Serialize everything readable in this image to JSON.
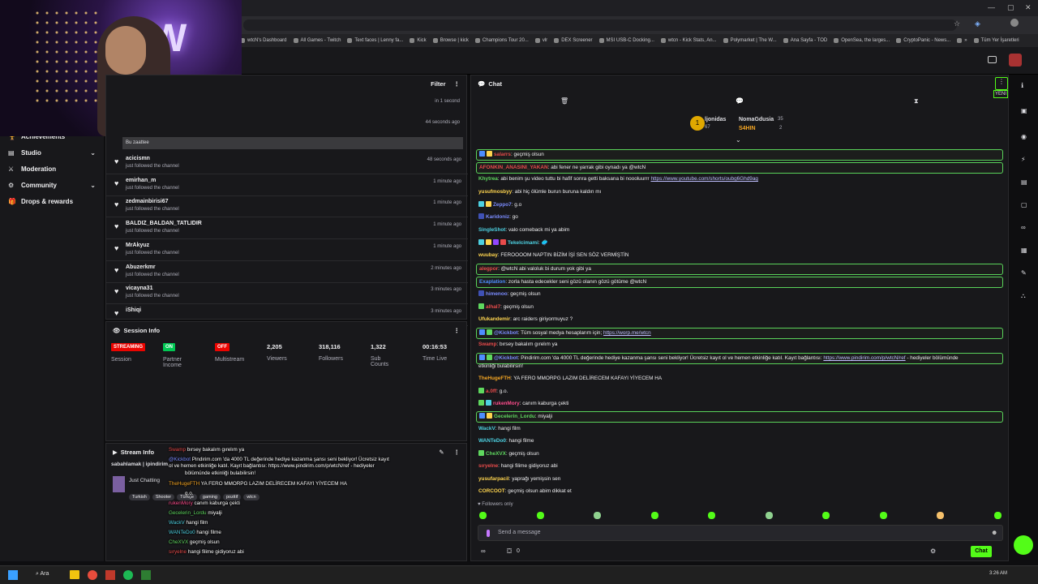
{
  "browser": {
    "bookmarks": [
      "wtcN's Dashboard",
      "All Games - Twitch",
      "Text faces | Lenny fa...",
      "Kick",
      "Browse | kick",
      "Champions Tour 20...",
      "vlr",
      "DEX Screener",
      "MSI USB-C Docking...",
      "wtcn - Kick Stats, An...",
      "Polymarket | The W...",
      "Ana Sayfa - TOD",
      "OpenSea, the larges...",
      "CryptoPanic - News...",
      "»",
      "Tüm Yer İşaretleri"
    ]
  },
  "sidebar": {
    "items": [
      {
        "label": "Achievements",
        "icon": "trophy-icon",
        "expand": false
      },
      {
        "label": "Studio",
        "icon": "studio-icon",
        "expand": true
      },
      {
        "label": "Moderation",
        "icon": "sword-icon",
        "expand": false
      },
      {
        "label": "Community",
        "icon": "gear-icon",
        "expand": true
      },
      {
        "label": "Drops & rewards",
        "icon": "gift-icon",
        "expand": false
      }
    ]
  },
  "activity": {
    "filter_label": "Filter",
    "top_times": [
      "in 1 second",
      "44 seconds ago"
    ],
    "banner_text": "Bu zaattee",
    "events": [
      {
        "user": "acicismn",
        "text": "just followed the channel",
        "time": "48 seconds ago"
      },
      {
        "user": "emirhan_m",
        "text": "just followed the channel",
        "time": "1 minute ago"
      },
      {
        "user": "zedmainbirisi67",
        "text": "just followed the channel",
        "time": "1 minute ago"
      },
      {
        "user": "BALDIZ_BALDAN_TATLIDIR",
        "text": "just followed the channel",
        "time": "1 minute ago"
      },
      {
        "user": "MrAkyuz",
        "text": "just followed the channel",
        "time": "1 minute ago"
      },
      {
        "user": "Abuzerkmr",
        "text": "just followed the channel",
        "time": "2 minutes ago"
      },
      {
        "user": "vicayna31",
        "text": "just followed the channel",
        "time": "3 minutes ago"
      },
      {
        "user": "iShiqi",
        "text": "",
        "time": "3 minutes ago"
      }
    ]
  },
  "session": {
    "title": "Session Info",
    "cols": [
      {
        "badge": "STREAMING",
        "badge_color": "#eb0400",
        "label": "Session"
      },
      {
        "badge": "ON",
        "badge_color": "#00c853",
        "label": "Partner Income"
      },
      {
        "badge": "OFF",
        "badge_color": "#eb0400",
        "label": "Multistream"
      },
      {
        "value": "2,205",
        "label": "Viewers"
      },
      {
        "value": "318,116",
        "label": "Followers"
      },
      {
        "value": "1,322",
        "label": "Sub Counts"
      },
      {
        "value": "00:16:53",
        "label": "Time Live"
      }
    ]
  },
  "stream_info": {
    "title": "Stream Info",
    "stream_title": "sabahlamak | ipindirim",
    "category": "Just Chatting",
    "tags": [
      "Turkish",
      "Shooter",
      "Türkçe",
      "gaming",
      "pozitif",
      "wtcn"
    ]
  },
  "overlay_lines": [
    {
      "name": "Swamp",
      "color": "#e84b4b",
      "text": "bırsey bakalım gırelım ya"
    },
    {
      "name": "@Kickbot",
      "color": "#7b8cff",
      "text": "Pindirim.com 'da 4000 TL değerinde hediye kazanma şansı seni bekliyor! Ücretsiz kayıt"
    },
    {
      "name": "",
      "color": "#fff",
      "text": "ol ve hemen etkinliğe katıl. Kayıt bağlantısı: https://www.pindirim.com/p/wtcN/ref - hediyeler"
    },
    {
      "name": "",
      "color": "#fff",
      "text": "bölümünde etkinliği bulabilirsin!"
    },
    {
      "name": "TheHugeFTH",
      "color": "#f5a623",
      "text": "YA FERO MMORPG LAZIM DELİRECEM KAFAYI YİYECEM HA"
    },
    {
      "name": "",
      "color": "#fff",
      "text": "g.o."
    },
    {
      "name": "rukenMory",
      "color": "#ff4d8d",
      "text": "canım kaburga çekti"
    },
    {
      "name": "Gecelerin_Lordu",
      "color": "#5fd85f",
      "text": "miyalji"
    },
    {
      "name": "WackV",
      "color": "#4dd0e1",
      "text": "hangi film"
    },
    {
      "name": "WANTeDo0",
      "color": "#4dd0e1",
      "text": "hangi filme"
    },
    {
      "name": "CheXVX",
      "color": "#5fd85f",
      "text": "geçmiş olsun"
    },
    {
      "name": "sıryelne",
      "color": "#e84b4b",
      "text": "hangi filime gidiyoruz abi"
    },
    {
      "name": "yusufarpacil",
      "color": "#ffd54f",
      "text": "yaprağı yemişsin sen"
    },
    {
      "name": "CORCOOT",
      "color": "#fff",
      "text": "geçmiş olsun abim dikkat et"
    }
  ],
  "chat": {
    "title": "Chat",
    "top_users": [
      {
        "name": "ljonidas",
        "count": "67"
      },
      {
        "name": "NomaGdusia",
        "count": "35"
      },
      {
        "name": "S4HIN",
        "count": "2"
      }
    ],
    "lines": [
      {
        "name": "salarrs",
        "color": "#e84b4b",
        "text": "geçmiş olsun",
        "hl": true,
        "icons": [
          "#4d8dff",
          "#ffd54f"
        ]
      },
      {
        "name": "AFONKIN_ANASINI_YAKAN",
        "color": "#e84b4b",
        "text": "abi fener ne yarrak gibi oynadı ya @wtcN",
        "hl": true,
        "icons": []
      },
      {
        "name": "Khytrea",
        "color": "#5fd85f",
        "text": "abi benim şu video tuttu bi hafif sonra getti baksana bi noooluurrr",
        "link": "https://www.youtube.com/shorts/oubg6Ghd9ag",
        "hl": false,
        "icons": []
      },
      {
        "name": "yusufmosbyy",
        "color": "#ffd54f",
        "text": "abi hiç ölümle burun buruna kaldın mı",
        "hl": false,
        "icons": []
      },
      {
        "name": "Zeppo7",
        "color": "#7b8cff",
        "text": "g.o",
        "hl": false,
        "icons": [
          "#4dd0e1",
          "#ffd54f"
        ]
      },
      {
        "name": "Karidoniz",
        "color": "#7b8cff",
        "text": "go",
        "hl": false,
        "icons": [
          "#3f51b5"
        ]
      },
      {
        "name": "SingleShot",
        "color": "#4dd0e1",
        "text": "valo comeback mi ya abim",
        "hl": false,
        "icons": []
      },
      {
        "name": "Tekelcimami",
        "color": "#4dd0e1",
        "text": "🥏",
        "hl": false,
        "icons": [
          "#4dd0e1",
          "#ffd54f",
          "#9146ff",
          "#e84b4b"
        ]
      },
      {
        "name": "wuubay",
        "color": "#ffd54f",
        "text": "FEROOOOM NAPTIN BİZİM İŞİ SEN SÖZ VERMİŞTİN",
        "hl": false,
        "icons": []
      },
      {
        "name": "alegpor",
        "color": "#e84b4b",
        "text": "@wtcN abi valoluk bi durum yok gibi ya",
        "hl": true,
        "icons": []
      },
      {
        "name": "Exaplation",
        "color": "#4d8dff",
        "text": "zorla hasta edecekler seni gözü olanın gözü götüme @wtcN",
        "hl": true,
        "icons": []
      },
      {
        "name": "himenoo",
        "color": "#7b8cff",
        "text": "geçmiş olsun",
        "hl": false,
        "icons": [
          "#3f51b5"
        ]
      },
      {
        "name": "alhal7",
        "color": "#e84b4b",
        "text": "geçmiş olsun",
        "hl": false,
        "icons": [
          "#5fd85f"
        ]
      },
      {
        "name": "Ufukandemir",
        "color": "#ffd54f",
        "text": "arc raiders giriyormuyuz ?",
        "hl": false,
        "icons": []
      },
      {
        "name": "@Kickbot",
        "color": "#7b8cff",
        "text": "Tüm sosyal medya hesaplarım için;",
        "link": "https://worp.me/wtcn",
        "hl": true,
        "icons": [
          "#4d8dff",
          "#5fd85f"
        ]
      },
      {
        "name": "Swamp",
        "color": "#e84b4b",
        "text": "bırsey bakalım gırelım ya",
        "hl": false,
        "icons": []
      },
      {
        "name": "@Kickbot",
        "color": "#7b8cff",
        "text": "Pindirim.com 'da 4000 TL değerinde hediye kazanma şansı seni bekliyor! Ücretsiz kayıt ol ve hemen etkinliğe katıl. Kayıt bağlantısı:",
        "link": "https://www.pindirim.com/p/wtcN/ref",
        "tail": "- hediyeler bölümünde",
        "hl": true,
        "icons": [
          "#4d8dff",
          "#5fd85f"
        ]
      },
      {
        "name": "",
        "color": "#efeff1",
        "text": "etkinliği bulabilirsin!",
        "hl": false,
        "icons": []
      },
      {
        "name": "TheHugeFTH",
        "color": "#f5a623",
        "text": "YA FERO MMORPG LAZIM DELİRECEM KAFAYI YİYECEM HA",
        "hl": false,
        "icons": []
      },
      {
        "name": "a.0ff",
        "color": "#e84b4b",
        "text": "g.o.",
        "hl": false,
        "icons": [
          "#5fd85f"
        ]
      },
      {
        "name": "rukenMory",
        "color": "#ff4d8d",
        "text": "canım kaburga çekti",
        "hl": false,
        "icons": [
          "#5fd85f",
          "#4dd0e1"
        ]
      },
      {
        "name": "Gecelerin_Lordu",
        "color": "#5fd85f",
        "text": "miyalji",
        "hl": true,
        "icons": [
          "#4d8dff",
          "#ffd54f"
        ]
      },
      {
        "name": "WackV",
        "color": "#4dd0e1",
        "text": "hangi film",
        "hl": false,
        "icons": []
      },
      {
        "name": "WANTeDo0",
        "color": "#4dd0e1",
        "text": "hangi filme",
        "hl": false,
        "icons": []
      },
      {
        "name": "CheXVX",
        "color": "#5fd85f",
        "text": "geçmiş olsun",
        "hl": false,
        "icons": [
          "#5fd85f"
        ]
      },
      {
        "name": "sıryelne",
        "color": "#e84b4b",
        "text": "hangi filime gidiyoruz abi",
        "hl": false,
        "icons": []
      },
      {
        "name": "yusufarpacil",
        "color": "#ffd54f",
        "text": "yaprağı yemişsin sen",
        "hl": false,
        "icons": []
      },
      {
        "name": "CORCOOT",
        "color": "#ffd54f",
        "text": "geçmiş olsun abim dikkat et",
        "hl": false,
        "icons": []
      }
    ],
    "followers_only": "Followers only",
    "input_placeholder": "Send a message",
    "points": "0",
    "send_label": "Chat",
    "new_badge": "YENİ"
  },
  "taskbar": {
    "search_label": "Ara",
    "time": "3:26 AM"
  },
  "colors": {
    "accent": "#53fc18",
    "panel": "#18181b",
    "bg": "#0e0e10"
  }
}
